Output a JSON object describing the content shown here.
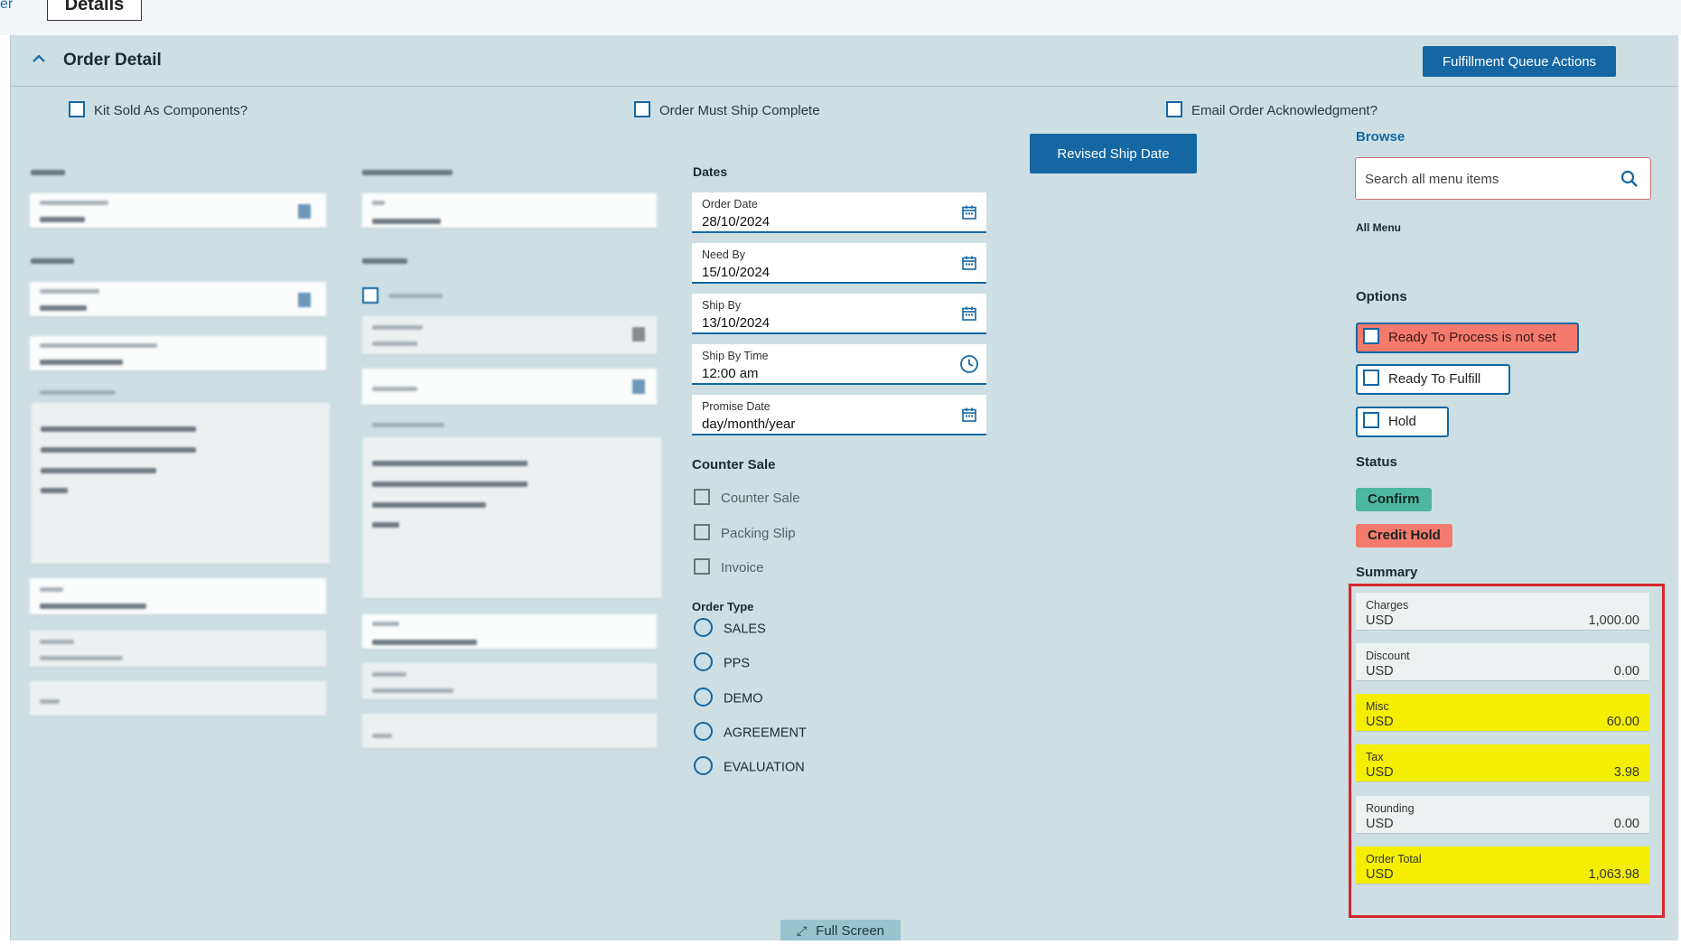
{
  "tabs": {
    "left_partial": "er",
    "details": "Details"
  },
  "header": {
    "title": "Order Detail",
    "fulfillment_button": "Fulfillment Queue Actions"
  },
  "top_checkboxes": {
    "kit": "Kit Sold As Components?",
    "ship_complete": "Order Must Ship Complete",
    "email_ack": "Email Order Acknowledgment?"
  },
  "dates": {
    "heading": "Dates",
    "order_date": {
      "label": "Order Date",
      "value": "28/10/2024"
    },
    "need_by": {
      "label": "Need By",
      "value": "15/10/2024"
    },
    "ship_by": {
      "label": "Ship By",
      "value": "13/10/2024"
    },
    "ship_by_time": {
      "label": "Ship By Time",
      "value": "12:00 am"
    },
    "promise_date": {
      "label": "Promise Date",
      "value": "day/month/year"
    }
  },
  "revised_ship_button": "Revised Ship Date",
  "counter_sale": {
    "heading": "Counter Sale",
    "items": [
      "Counter Sale",
      "Packing Slip",
      "Invoice"
    ]
  },
  "order_type": {
    "heading": "Order Type",
    "options": [
      "SALES",
      "PPS",
      "DEMO",
      "AGREEMENT",
      "EVALUATION"
    ]
  },
  "browse": {
    "heading": "Browse",
    "placeholder": "Search all menu items",
    "all_menu": "All Menu"
  },
  "options": {
    "heading": "Options",
    "ready_process": "Ready To Process is not set",
    "ready_fulfill": "Ready To Fulfill",
    "hold": "Hold"
  },
  "status": {
    "heading": "Status",
    "confirm": "Confirm",
    "credit_hold": "Credit Hold"
  },
  "summary": {
    "heading": "Summary",
    "rows": [
      {
        "label": "Charges",
        "currency": "USD",
        "value": "1,000.00"
      },
      {
        "label": "Discount",
        "currency": "USD",
        "value": "0.00"
      },
      {
        "label": "Misc",
        "currency": "USD",
        "value": "60.00"
      },
      {
        "label": "Tax",
        "currency": "USD",
        "value": "3.98"
      },
      {
        "label": "Rounding",
        "currency": "USD",
        "value": "0.00"
      },
      {
        "label": "Order Total",
        "currency": "USD",
        "value": "1,063.98"
      }
    ]
  },
  "full_screen": "Full Screen",
  "colors": {
    "panel_bg": "#cddfe3",
    "accent_blue": "#1467a3",
    "confirm_green": "#4db8a1",
    "credit_red": "#f57a6e",
    "highlight_yellow": "#f4ef02",
    "annotation_red": "#d9262e"
  }
}
